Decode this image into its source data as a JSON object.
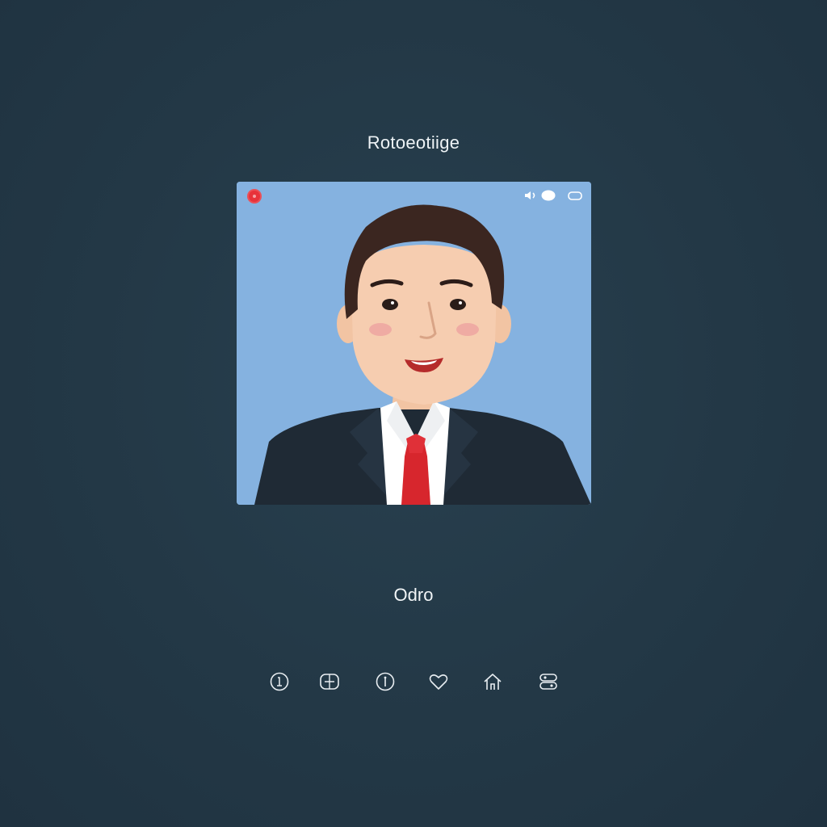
{
  "header": {
    "title": "Rotoeotiige"
  },
  "photo_card": {
    "record_icon": "record-icon",
    "controls": [
      "volume-icon",
      "toggle-icon",
      "expand-icon"
    ],
    "colors": {
      "background": "#85b2e0",
      "record": "#e8323a"
    }
  },
  "profile": {
    "name": "Odro"
  },
  "action_bar": {
    "icons": [
      "info-icon",
      "gallery-icon",
      "info-icon",
      "heart-icon",
      "home-icon",
      "settings-icon"
    ]
  },
  "colors": {
    "page_background": "#243847",
    "text": "#eef3f6"
  }
}
